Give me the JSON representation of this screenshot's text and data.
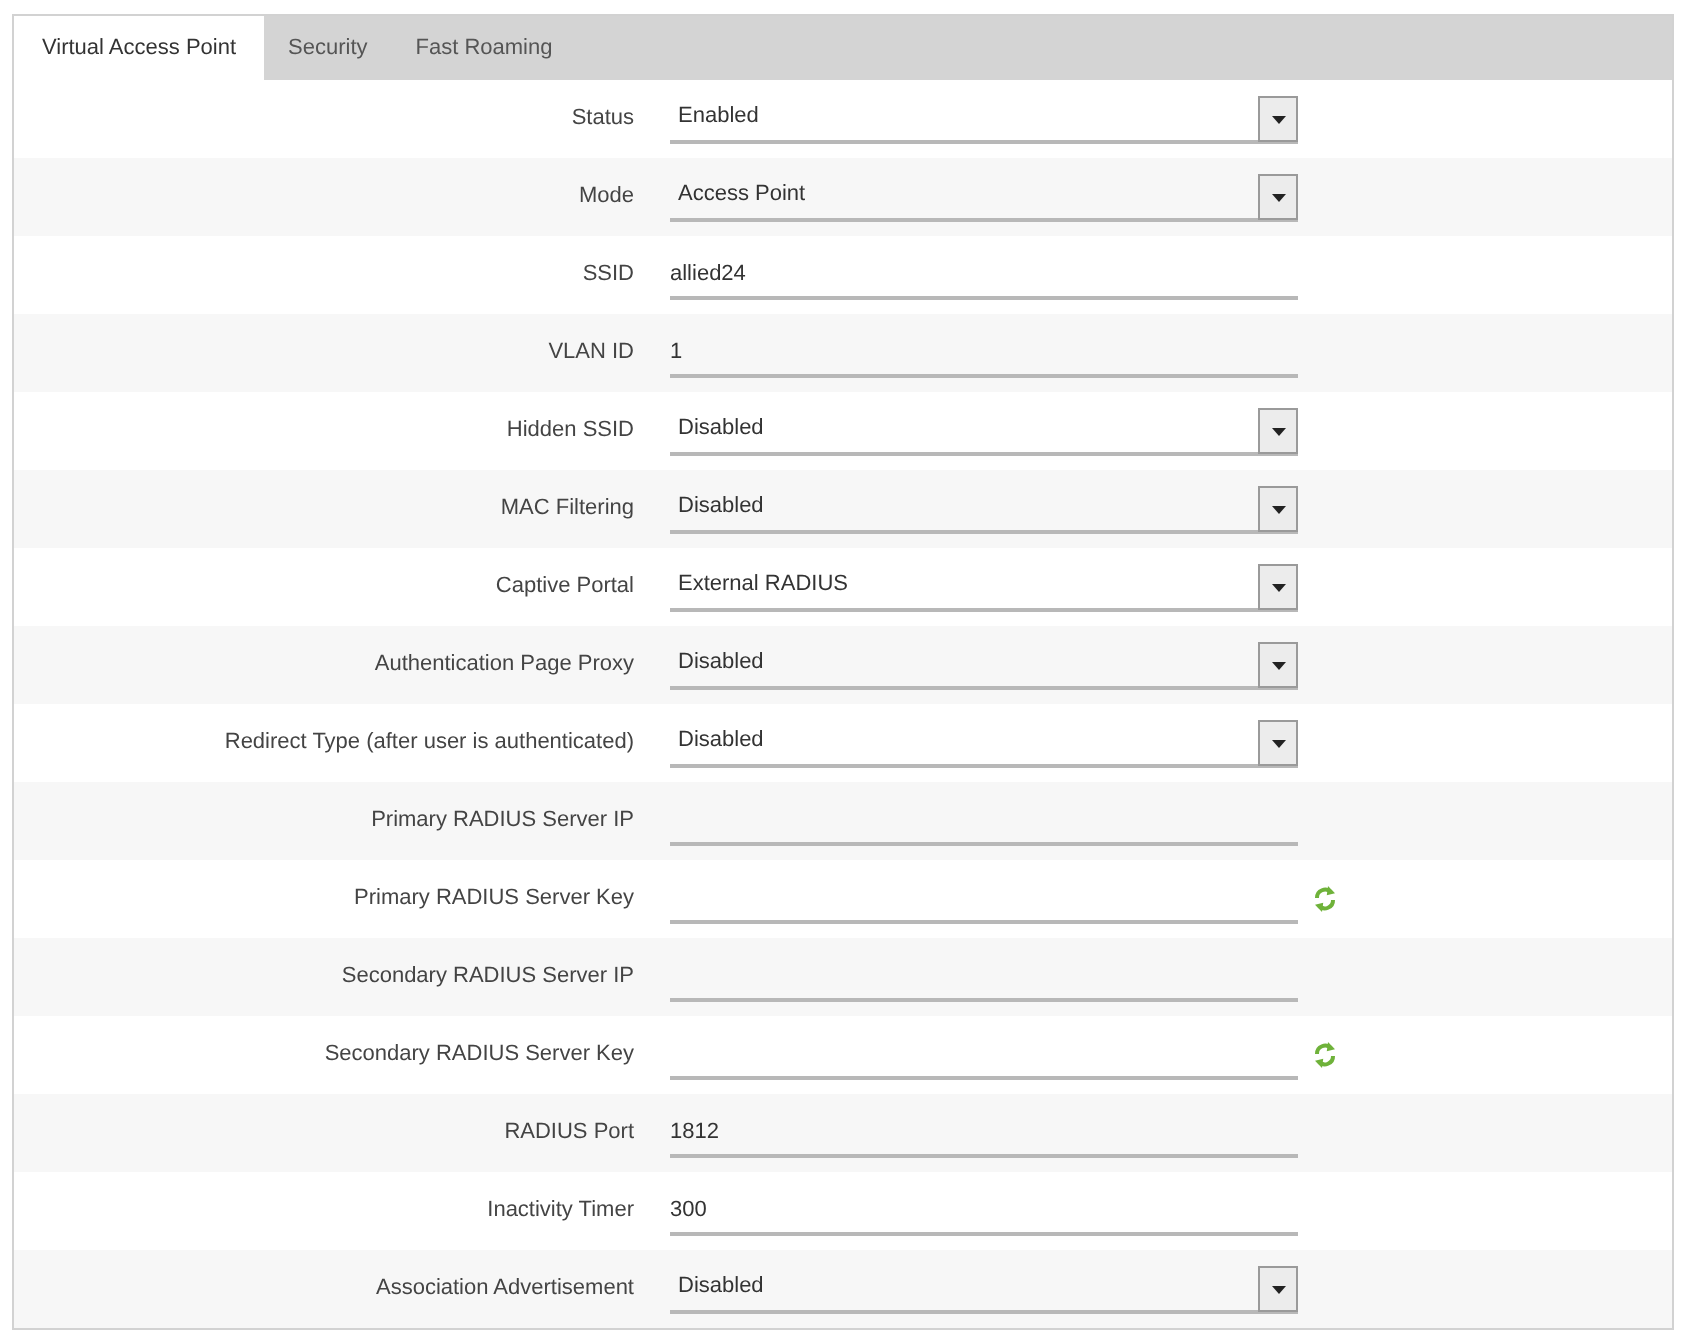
{
  "tabs": [
    {
      "label": "Virtual Access Point",
      "selected": true
    },
    {
      "label": "Security",
      "selected": false
    },
    {
      "label": "Fast Roaming",
      "selected": false
    }
  ],
  "fields": [
    {
      "label": "Status",
      "kind": "dropdown",
      "value": "Enabled"
    },
    {
      "label": "Mode",
      "kind": "dropdown",
      "value": "Access Point"
    },
    {
      "label": "SSID",
      "kind": "text",
      "value": "allied24"
    },
    {
      "label": "VLAN ID",
      "kind": "text",
      "value": "1"
    },
    {
      "label": "Hidden SSID",
      "kind": "dropdown",
      "value": "Disabled"
    },
    {
      "label": "MAC Filtering",
      "kind": "dropdown",
      "value": "Disabled"
    },
    {
      "label": "Captive Portal",
      "kind": "dropdown",
      "value": "External RADIUS"
    },
    {
      "label": "Authentication Page Proxy",
      "kind": "dropdown",
      "value": "Disabled"
    },
    {
      "label": "Redirect Type (after user is authenticated)",
      "kind": "dropdown",
      "value": "Disabled"
    },
    {
      "label": "Primary RADIUS Server IP",
      "kind": "text"
    },
    {
      "label": "Primary RADIUS Server Key",
      "kind": "key"
    },
    {
      "label": "Secondary RADIUS Server IP",
      "kind": "text"
    },
    {
      "label": "Secondary RADIUS Server Key",
      "kind": "key"
    },
    {
      "label": "RADIUS Port",
      "kind": "text",
      "value": "1812"
    },
    {
      "label": "Inactivity Timer",
      "kind": "text",
      "value": "300"
    },
    {
      "label": "Association Advertisement",
      "kind": "dropdown",
      "value": "Disabled"
    }
  ]
}
